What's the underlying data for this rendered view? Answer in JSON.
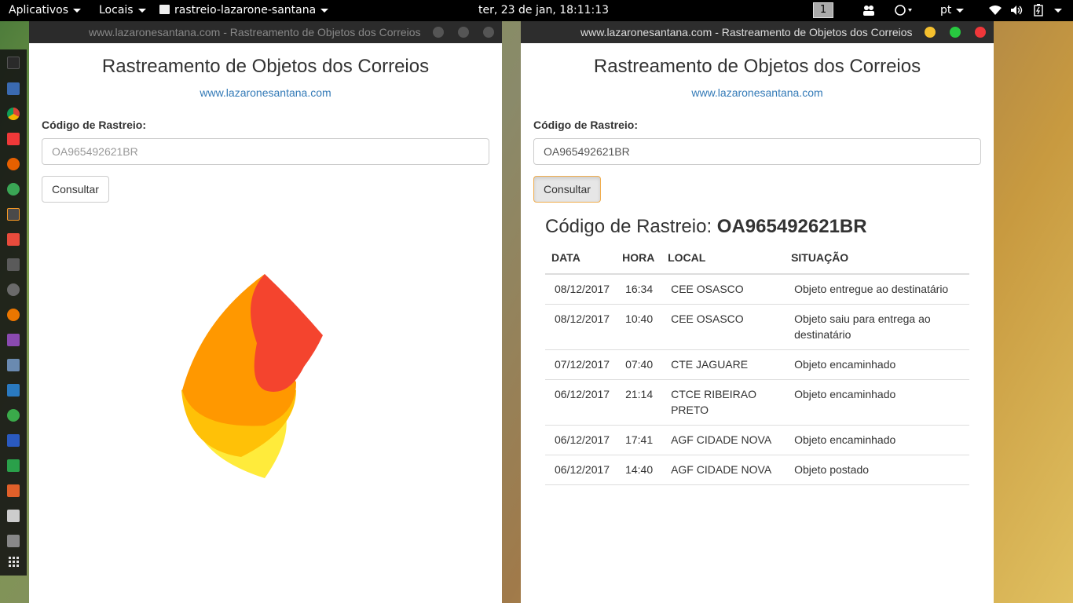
{
  "topbar": {
    "apps_menu": "Aplicativos",
    "places_menu": "Locais",
    "active_app": "rastreio-lazarone-santana",
    "clock": "ter, 23 de jan, 18:11:13",
    "workspace": "1",
    "language": "pt"
  },
  "dock": {
    "icons": [
      "terminal-icon",
      "text-editor-icon",
      "chrome-icon",
      "vivaldi-icon",
      "firefox-icon",
      "web-icon",
      "sublime-icon",
      "draw-icon",
      "gimp-icon",
      "settings-icon",
      "blender-icon",
      "video-icon",
      "screenshot-icon",
      "monitor-icon",
      "money-icon",
      "writer-icon",
      "calc-icon",
      "impress-icon",
      "notes-icon",
      "files-icon",
      "apps-grid-icon"
    ]
  },
  "left_window": {
    "title": "www.lazaronesantana.com - Rastreamento de Objetos dos Correios",
    "app_title": "Rastreamento de Objetos dos Correios",
    "site_link": "www.lazaronesantana.com",
    "field_label": "Código de Rastreio:",
    "input_placeholder": "OA965492621BR",
    "button_label": "Consultar"
  },
  "right_window": {
    "title": "www.lazaronesantana.com - Rastreamento de Objetos dos Correios",
    "app_title": "Rastreamento de Objetos dos Correios",
    "site_link": "www.lazaronesantana.com",
    "field_label": "Código de Rastreio:",
    "input_value": "OA965492621BR",
    "button_label": "Consultar",
    "result_prefix": "Código de Rastreio:",
    "result_code": "OA965492621BR",
    "table": {
      "headers": [
        "DATA",
        "HORA",
        "LOCAL",
        "SITUAÇÃO"
      ],
      "rows": [
        [
          "08/12/2017",
          "16:34",
          "CEE OSASCO",
          "Objeto entregue ao destinatário"
        ],
        [
          "08/12/2017",
          "10:40",
          "CEE OSASCO",
          "Objeto saiu para entrega ao destinatário"
        ],
        [
          "07/12/2017",
          "07:40",
          "CTE JAGUARE",
          "Objeto encaminhado"
        ],
        [
          "06/12/2017",
          "21:14",
          "CTCE RIBEIRAO PRETO",
          "Objeto encaminhado"
        ],
        [
          "06/12/2017",
          "17:41",
          "AGF CIDADE NOVA",
          "Objeto encaminhado"
        ],
        [
          "06/12/2017",
          "14:40",
          "AGF CIDADE NOVA",
          "Objeto postado"
        ]
      ]
    }
  },
  "colors": {
    "link": "#337ab7",
    "btn_min": "#f5c02e",
    "btn_max": "#28c940",
    "btn_close": "#f0373a"
  }
}
